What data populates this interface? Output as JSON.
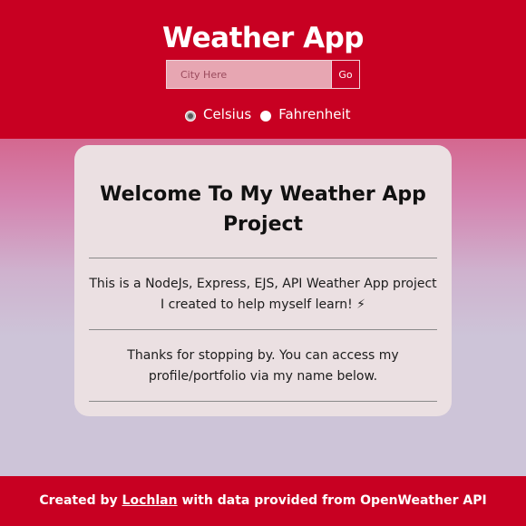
{
  "header": {
    "title": "Weather App",
    "search_placeholder": "City Here",
    "go_label": "Go",
    "units": [
      {
        "label": "Celsius",
        "checked": true
      },
      {
        "label": "Fahrenheit",
        "checked": false
      }
    ]
  },
  "card": {
    "title": "Welcome To My Weather App Project",
    "paragraph1": "This is a NodeJs, Express, EJS, API Weather App project I created to help myself learn! ⚡",
    "paragraph2": "Thanks for stopping by. You can access my profile/portfolio via my name below."
  },
  "footer": {
    "prefix": "Created by",
    "author_link": "Lochlan",
    "suffix": "with data provided from OpenWeather API"
  },
  "colors": {
    "header_bg": "#c80022",
    "card_bg": "#ebe0e2",
    "footer_bg": "#c80022"
  }
}
